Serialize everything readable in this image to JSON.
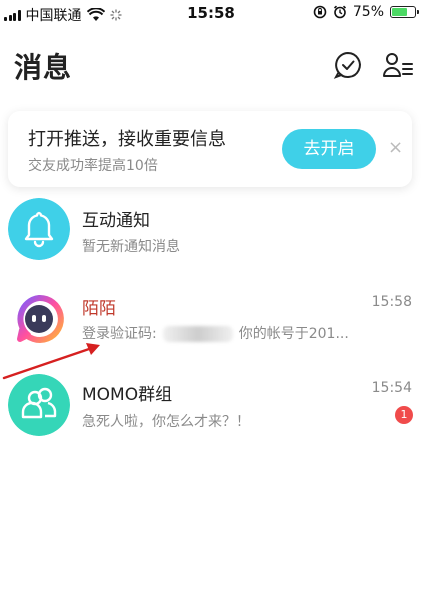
{
  "status_bar": {
    "carrier": "中国联通",
    "time": "15:58",
    "battery_percent_text": "75%",
    "battery_level": 0.75
  },
  "header": {
    "title": "消息",
    "icons": [
      "chat-check-icon",
      "contacts-icon"
    ]
  },
  "push_banner": {
    "title": "打开推送，接收重要信息",
    "subtitle": "交友成功率提高10倍",
    "button_label": "去开启",
    "close_label": "×"
  },
  "messages": [
    {
      "title": "互动通知",
      "preview": "暂无新通知消息",
      "time": "",
      "icon": "bell-icon",
      "color": "#3fd0e8"
    },
    {
      "title": "陌陌",
      "preview_prefix": "登录验证码:",
      "preview_suffix": "你的帐号于201...",
      "time": "15:58",
      "icon": "momo-logo-icon",
      "color": "#c0392b"
    },
    {
      "title": "MOMO群组",
      "preview": "急死人啦，你怎么才来？！",
      "time": "15:54",
      "badge": "1",
      "icon": "group-icon",
      "color": "#35d6b8"
    }
  ],
  "colors": {
    "accent": "#3fd0e8",
    "badge": "#f04b4b",
    "momo_title": "#c0392b"
  }
}
